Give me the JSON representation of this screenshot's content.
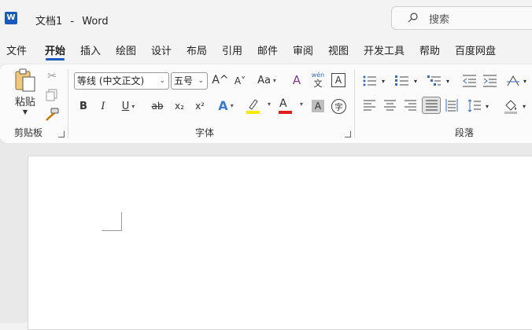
{
  "titlebar": {
    "app_logo": "W",
    "doc_name": "文档1",
    "separator": "-",
    "app_name": "Word"
  },
  "search": {
    "label": "搜索"
  },
  "tabs": [
    "文件",
    "开始",
    "插入",
    "绘图",
    "设计",
    "布局",
    "引用",
    "邮件",
    "审阅",
    "视图",
    "开发工具",
    "帮助",
    "百度网盘"
  ],
  "ribbon": {
    "clipboard": {
      "paste_label": "粘贴",
      "group_label": "剪贴板"
    },
    "font": {
      "font_name": "等线 (中文正文)",
      "font_size": "五号",
      "grow_label": "A^",
      "shrink_label": "A˅",
      "case_label": "Aa",
      "phonetic_top": "wén",
      "phonetic_bottom": "文",
      "border_char": "A",
      "bold": "B",
      "italic": "I",
      "underline": "U",
      "strike": "ab",
      "subscript": "x₂",
      "superscript": "x²",
      "effects": "A",
      "highlight": "ab",
      "font_color": "A",
      "shade": "A",
      "enclose": "字",
      "group_label": "字体"
    },
    "paragraph": {
      "group_label": "段落"
    }
  },
  "colors": {
    "accent": "#185abd",
    "highlight": "#ffeb00",
    "font_red": "#e02020"
  }
}
